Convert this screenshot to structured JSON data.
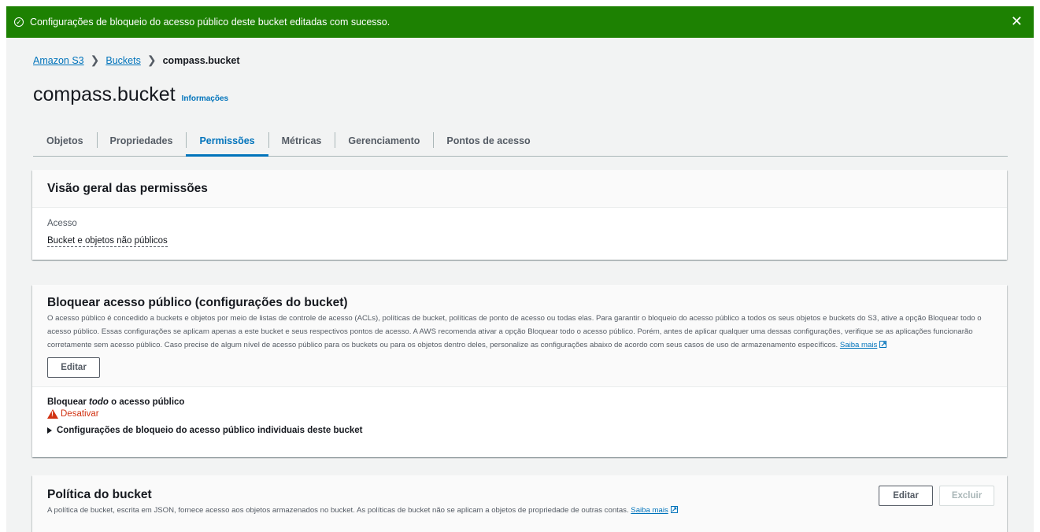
{
  "flash": {
    "message": "Configurações de bloqueio do acesso público deste bucket editadas com sucesso.",
    "close_label": "✕"
  },
  "breadcrumb": {
    "items": [
      "Amazon S3",
      "Buckets"
    ],
    "current": "compass.bucket"
  },
  "page": {
    "title": "compass.bucket",
    "info_link": "Informações"
  },
  "tabs": [
    {
      "label": "Objetos"
    },
    {
      "label": "Propriedades"
    },
    {
      "label": "Permissões"
    },
    {
      "label": "Métricas"
    },
    {
      "label": "Gerenciamento"
    },
    {
      "label": "Pontos de acesso"
    }
  ],
  "overview": {
    "heading": "Visão geral das permissões",
    "access_label": "Acesso",
    "access_value": "Bucket e objetos não públicos"
  },
  "block_public": {
    "heading": "Bloquear acesso público (configurações do bucket)",
    "description": "O acesso público é concedido a buckets e objetos por meio de listas de controle de acesso (ACLs), políticas de bucket, políticas de ponto de acesso ou todas elas. Para garantir o bloqueio do acesso público a todos os seus objetos e buckets do S3, ative a opção Bloquear todo o acesso público. Essas configurações se aplicam apenas a este bucket e seus respectivos pontos de acesso. A AWS recomenda ativar a opção Bloquear todo o acesso público. Porém, antes de aplicar qualquer uma dessas configurações, verifique se as aplicações funcionarão corretamente sem acesso público. Caso precise de algum nível de acesso público para os buckets ou para os objetos dentro deles, personalize as configurações abaixo de acordo com seus casos de uso de armazenamento específicos.",
    "learn_more": "Saiba mais",
    "edit_label": "Editar",
    "setting_prefix": "Bloquear ",
    "setting_emph": "todo",
    "setting_suffix": " o acesso público",
    "status": "Desativar",
    "expander": "Configurações de bloqueio do acesso público individuais deste bucket"
  },
  "bucket_policy": {
    "heading": "Política do bucket",
    "description": "A política de bucket, escrita em JSON, fornece acesso aos objetos armazenados no bucket. As políticas de bucket não se aplicam a objetos de propriedade de outras contas.",
    "learn_more": "Saiba mais",
    "edit_label": "Editar",
    "delete_label": "Excluir"
  },
  "colors": {
    "success": "#1d8102",
    "link": "#0073bb",
    "warning": "#d13212"
  }
}
